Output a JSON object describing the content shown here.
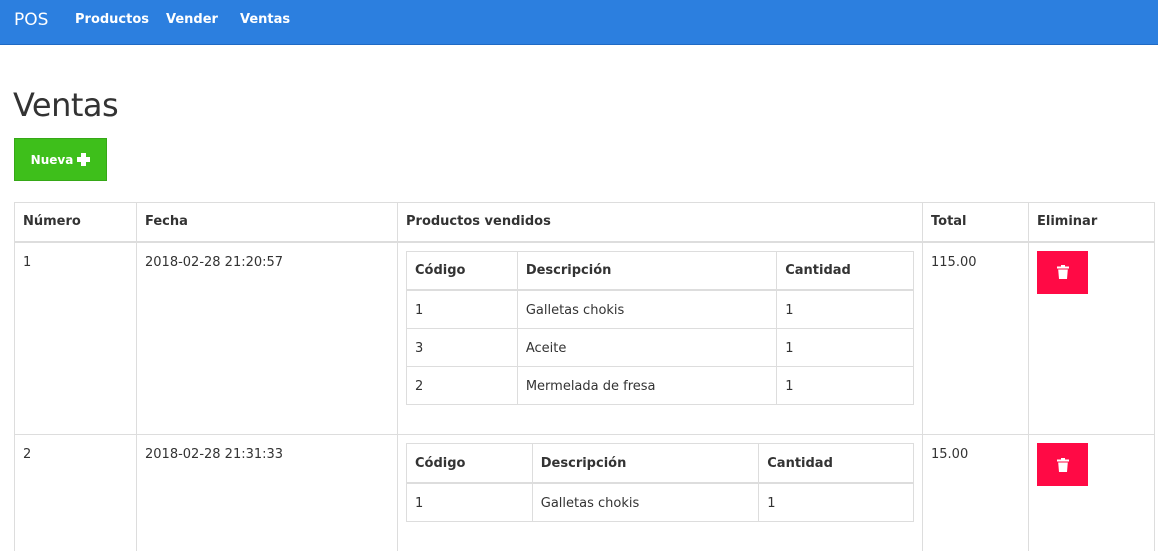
{
  "navbar": {
    "brand": "POS",
    "links": [
      "Productos",
      "Vender",
      "Ventas"
    ]
  },
  "page": {
    "title": "Ventas",
    "new_button_label": "Nueva"
  },
  "table": {
    "headers": [
      "Número",
      "Fecha",
      "Productos vendidos",
      "Total",
      "Eliminar"
    ],
    "product_headers": [
      "Código",
      "Descripción",
      "Cantidad"
    ],
    "rows": [
      {
        "numero": "1",
        "fecha": "2018-02-28 21:20:57",
        "total": "115.00",
        "productos": [
          {
            "codigo": "1",
            "descripcion": "Galletas chokis",
            "cantidad": "1"
          },
          {
            "codigo": "3",
            "descripcion": "Aceite",
            "cantidad": "1"
          },
          {
            "codigo": "2",
            "descripcion": "Mermelada de fresa",
            "cantidad": "1"
          }
        ]
      },
      {
        "numero": "2",
        "fecha": "2018-02-28 21:31:33",
        "total": "15.00",
        "productos": [
          {
            "codigo": "1",
            "descripcion": "Galletas chokis",
            "cantidad": "1"
          }
        ]
      }
    ]
  },
  "colors": {
    "navbar": "#2c7fdf",
    "new_button": "#3ebf1b",
    "delete_button": "#ff0a45"
  },
  "icons": {
    "new_button": "plus-icon",
    "delete_button": "trash-icon"
  }
}
